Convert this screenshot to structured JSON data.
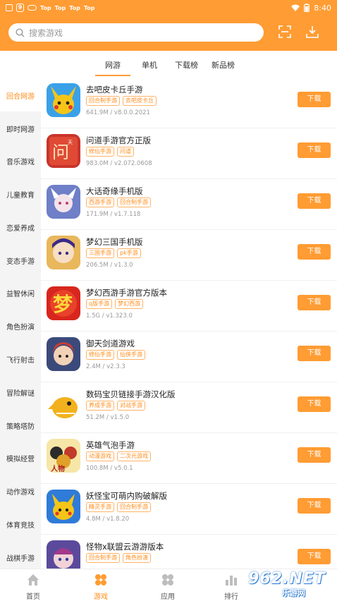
{
  "status_bar": {
    "top_labels": [
      "Top",
      "Top",
      "Top",
      "Top"
    ],
    "time": "8:40",
    "g_label": "9"
  },
  "search": {
    "placeholder": "搜索游戏"
  },
  "tabs": [
    "网游",
    "单机",
    "下载榜",
    "新品榜"
  ],
  "active_tab": "网游",
  "sidebar": [
    "回合网游",
    "即时网游",
    "音乐游戏",
    "儿童教育",
    "恋爱养成",
    "变态手游",
    "益智休闲",
    "角色扮演",
    "飞行射击",
    "冒险解谜",
    "策略塔防",
    "模拟经营",
    "动作游戏",
    "体育竞技",
    "战棋手游"
  ],
  "active_sidebar": "回合网游",
  "download_label": "下载",
  "apps": [
    {
      "name": "去吧皮卡丘手游",
      "tags": [
        "回合制手游",
        "去吧皮卡丘"
      ],
      "meta": "641.9M / v8.0.0.2021",
      "icon": "pikachu-icon",
      "color": "#f5c518"
    },
    {
      "name": "问道手游官方正版",
      "tags": [
        "修仙手游",
        "问道"
      ],
      "meta": "983.0M / v2.072.0608",
      "icon": "wendao-icon",
      "color": "#c8342b"
    },
    {
      "name": "大话奇缘手机版",
      "tags": [
        "西游手游",
        "回合制手游"
      ],
      "meta": "171.9M / v1.7.118",
      "icon": "dahua-icon",
      "color": "#6f7fc8"
    },
    {
      "name": "梦幻三国手机版",
      "tags": [
        "三国手游",
        "pk手游"
      ],
      "meta": "206.5M / v1.3.0",
      "icon": "sanguo-icon",
      "color": "#d9a24a"
    },
    {
      "name": "梦幻西游手游官方版本",
      "tags": [
        "q版手游",
        "梦幻西游"
      ],
      "meta": "1.5G / v1.323.0",
      "icon": "menghuan-icon",
      "color": "#d8261e"
    },
    {
      "name": "御天剑道游戏",
      "tags": [
        "修仙手游",
        "仙侠手游"
      ],
      "meta": "2.4M / v2.3.3",
      "icon": "jiandao-icon",
      "color": "#c43d3a"
    },
    {
      "name": "数码宝贝链接手游汉化版",
      "tags": [
        "养成手游",
        "对战手游"
      ],
      "meta": "51.2M / v1.5.0",
      "icon": "digimon-icon",
      "color": "#f2b21d"
    },
    {
      "name": "英雄气泡手游",
      "tags": [
        "动漫游戏",
        "二次元游戏"
      ],
      "meta": "100.8M / v5.0.1",
      "icon": "hero-bubble-icon",
      "color": "#e0a12a"
    },
    {
      "name": "妖怪宝可萌内购破解版",
      "tags": [
        "精灵手游",
        "回合制手游"
      ],
      "meta": "4.8M / v1.8.20",
      "icon": "pokemon-icon",
      "color": "#2f7bd8"
    },
    {
      "name": "怪物x联盟云游游版本",
      "tags": [
        "回合制手游",
        "角色扮演"
      ],
      "meta": "",
      "icon": "monster-icon",
      "color": "#5b4a9c"
    }
  ],
  "bottom_nav": [
    {
      "label": "首页",
      "icon": "home-icon"
    },
    {
      "label": "游戏",
      "icon": "game-icon"
    },
    {
      "label": "应用",
      "icon": "apps-icon"
    },
    {
      "label": "排行",
      "icon": "rank-icon"
    }
  ],
  "active_nav": "游戏",
  "watermark": {
    "number": "962.NET",
    "sub": "乐游网"
  },
  "colors": {
    "accent": "#ff9c33",
    "text_active": "#ff8c1a"
  }
}
